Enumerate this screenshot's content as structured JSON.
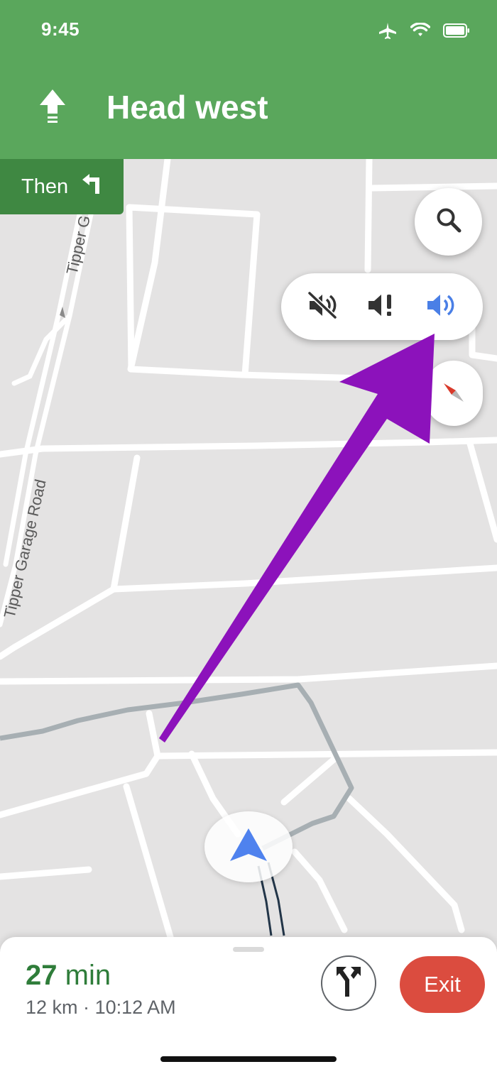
{
  "status_bar": {
    "time": "9:45",
    "icons": [
      "airplane-icon",
      "wifi-icon",
      "battery-icon"
    ]
  },
  "navigation": {
    "instruction": "Head west",
    "instruction_icon": "straight-arrow-icon",
    "next_label": "Then",
    "next_icon": "turn-left-icon"
  },
  "map": {
    "road_labels": [
      "Tipper Garage Road",
      "Tipper G"
    ]
  },
  "controls": {
    "search_icon": "search-icon",
    "sound_options": [
      "mute-icon",
      "alerts-only-icon",
      "unmute-icon"
    ],
    "selected_sound": "unmute-icon",
    "compass_icon": "compass-icon"
  },
  "trip": {
    "eta_value": "27",
    "eta_unit": "min",
    "distance": "12 km",
    "separator": "·",
    "arrival_time": "10:12 AM",
    "exit_label": "Exit"
  },
  "colors": {
    "header_green": "#5aa75c",
    "then_green": "#3f8842",
    "eta_green": "#2f7d3a",
    "exit_red": "#db4c3f",
    "selected_blue": "#4a7fe6",
    "annotation_purple": "#8c12bb"
  }
}
